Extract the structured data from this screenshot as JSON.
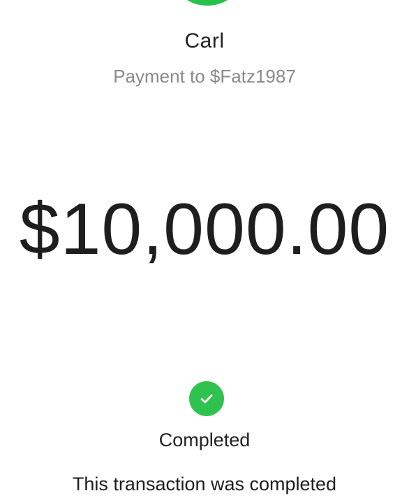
{
  "recipient": {
    "name": "Carl",
    "payment_to": "Payment to $Fatz1987",
    "avatar_color": "#27c24c"
  },
  "amount": "$10,000.00",
  "status": {
    "icon": "check-circle-icon",
    "icon_color": "#2fc24f",
    "label": "Completed",
    "description": "This transaction was completed"
  }
}
